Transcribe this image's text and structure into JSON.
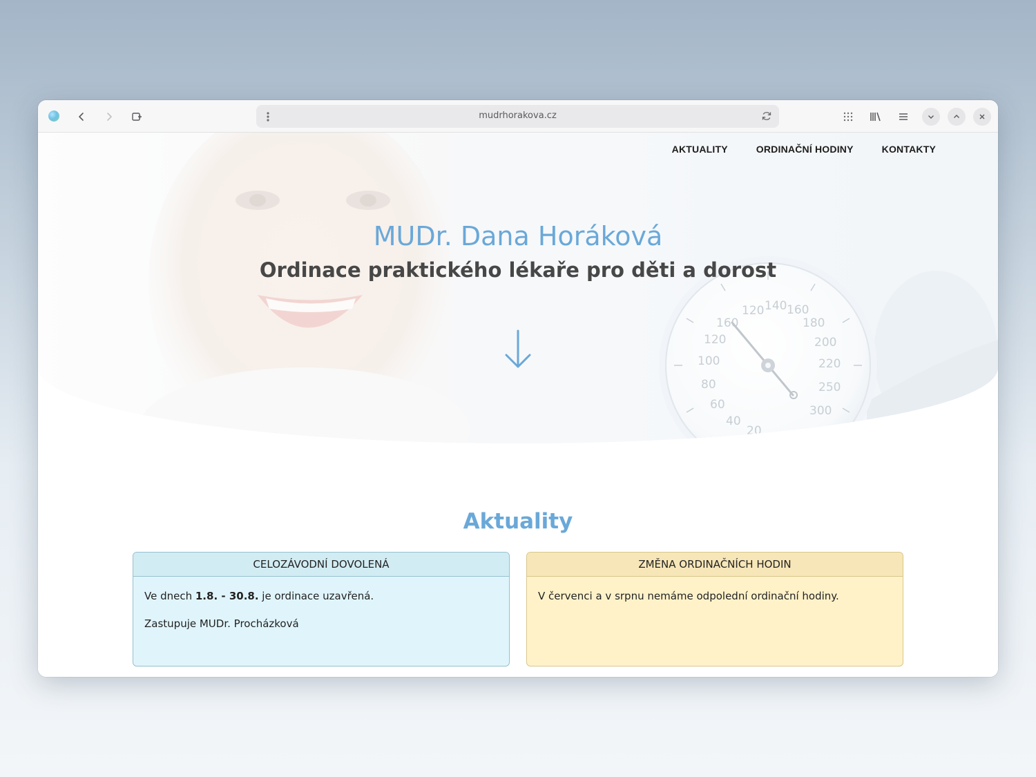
{
  "browser": {
    "url": "mudrhorakova.cz"
  },
  "nav": {
    "items": [
      "AKTUALITY",
      "ORDINAČNÍ HODINY",
      "KONTAKTY"
    ]
  },
  "hero": {
    "title": "MUDr. Dana Horáková",
    "subtitle": "Ordinace praktického lékaře pro děti a dorost",
    "gauge_numbers": [
      "20",
      "40",
      "60",
      "80",
      "100",
      "120",
      "160",
      "120",
      "140",
      "160",
      "180",
      "200",
      "220",
      "250",
      "300"
    ]
  },
  "news": {
    "heading": "Aktuality",
    "cards": [
      {
        "title": "CELOZÁVODNÍ DOVOLENÁ",
        "line1_prefix": "Ve dnech ",
        "line1_bold": "1.8. - 30.8.",
        "line1_suffix": " je ordinace uzavřená.",
        "line2": "Zastupuje MUDr. Procházková"
      },
      {
        "title": "ZMĚNA ORDINAČNÍCH HODIN",
        "line1": "V červenci a v srpnu nemáme odpolední ordinační hodiny."
      }
    ]
  },
  "colors": {
    "accent": "#6aa8d8",
    "card_blue_bg": "#e0f5fb",
    "card_yellow_bg": "#fff2c9"
  }
}
